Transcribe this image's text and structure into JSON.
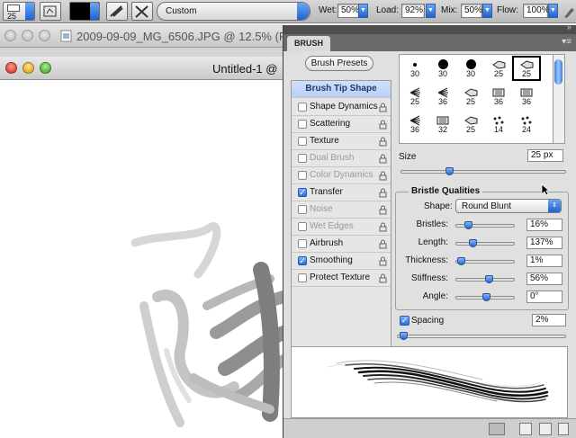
{
  "options_bar": {
    "brush_size": "25",
    "preset": "Custom",
    "wet_label": "Wet:",
    "wet_value": "50%",
    "load_label": "Load:",
    "load_value": "92%",
    "mix_label": "Mix:",
    "mix_value": "50%",
    "flow_label": "Flow:",
    "flow_value": "100%"
  },
  "document_tab": {
    "title": "2009-09-09_MG_6506.JPG @ 12.5% (R"
  },
  "window": {
    "title": "Untitled-1 @"
  },
  "panel": {
    "tab": "BRUSH",
    "presets_button": "Brush Presets",
    "items": [
      {
        "label": "Brush Tip Shape"
      },
      {
        "label": "Shape Dynamics",
        "checked": false,
        "enabled": true
      },
      {
        "label": "Scattering",
        "checked": false,
        "enabled": true
      },
      {
        "label": "Texture",
        "checked": false,
        "enabled": true
      },
      {
        "label": "Dual Brush",
        "checked": false,
        "enabled": false
      },
      {
        "label": "Color Dynamics",
        "checked": false,
        "enabled": false
      },
      {
        "label": "Transfer",
        "checked": true,
        "enabled": true
      },
      {
        "label": "Noise",
        "checked": false,
        "enabled": false
      },
      {
        "label": "Wet Edges",
        "checked": false,
        "enabled": false
      },
      {
        "label": "Airbrush",
        "checked": false,
        "enabled": true
      },
      {
        "label": "Smoothing",
        "checked": true,
        "enabled": true
      },
      {
        "label": "Protect Texture",
        "checked": false,
        "enabled": true
      }
    ],
    "grid_rows": [
      [
        "30",
        "30",
        "30",
        "25",
        "25"
      ],
      [
        "25",
        "36",
        "25",
        "36",
        "36"
      ],
      [
        "36",
        "32",
        "25",
        "14",
        "24"
      ]
    ],
    "size_label": "Size",
    "size_value": "25 px",
    "size_fraction": 0.05,
    "bristle": {
      "title": "Bristle Qualities",
      "shape_label": "Shape:",
      "shape_value": "Round Blunt",
      "rows": [
        {
          "label": "Bristles:",
          "value": "16%",
          "fraction": 0.16
        },
        {
          "label": "Length:",
          "value": "137%",
          "fraction": 0.25
        },
        {
          "label": "Thickness:",
          "value": "1%",
          "fraction": 0.01
        },
        {
          "label": "Stiffness:",
          "value": "56%",
          "fraction": 0.56
        },
        {
          "label": "Angle:",
          "value": "0°",
          "fraction": 0.5
        }
      ]
    },
    "spacing_label": "Spacing",
    "spacing_value": "2%",
    "spacing_checked": true,
    "spacing_fraction": 0.01
  }
}
